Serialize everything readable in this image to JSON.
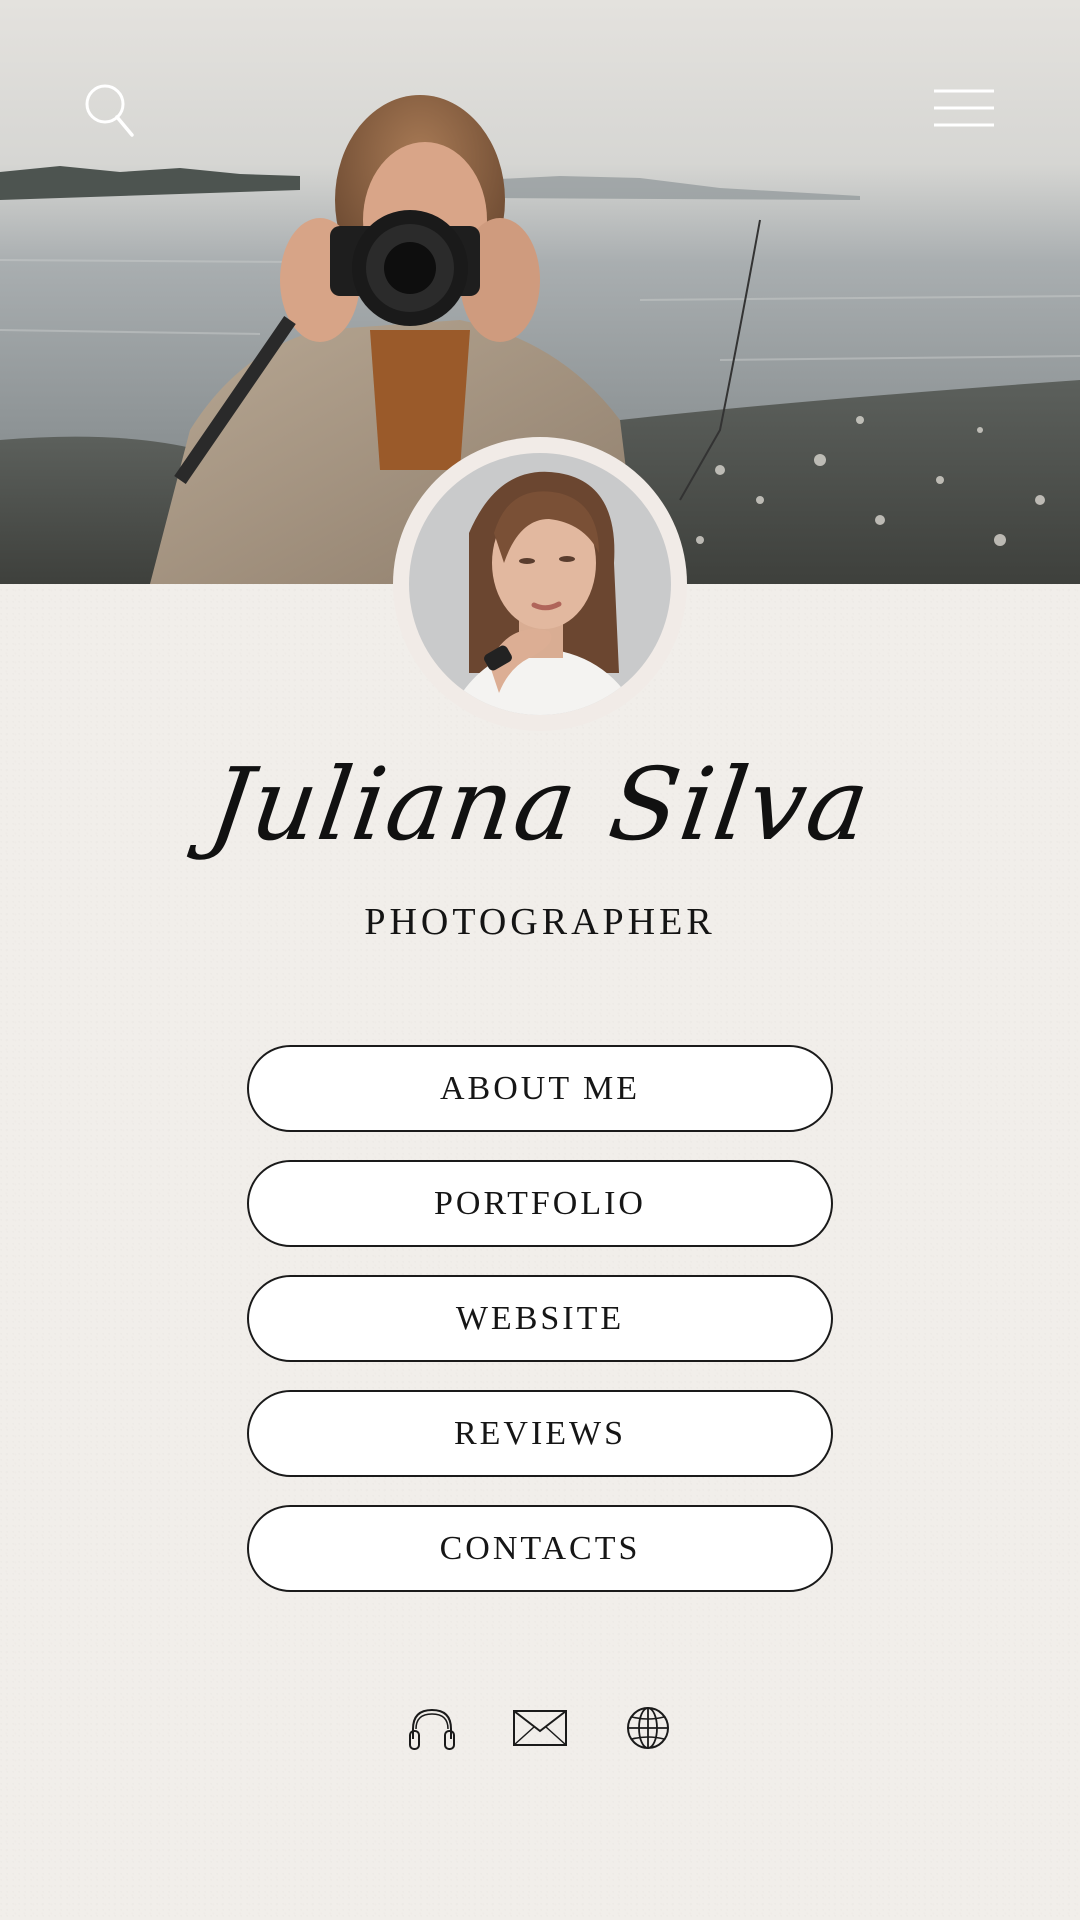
{
  "profile": {
    "name": "Juliana Silva",
    "role": "PHOTOGRAPHER"
  },
  "header": {
    "search_icon": "search-icon",
    "menu_icon": "hamburger-menu-icon"
  },
  "links": [
    {
      "label": "ABOUT ME"
    },
    {
      "label": "PORTFOLIO"
    },
    {
      "label": "WEBSITE"
    },
    {
      "label": "REVIEWS"
    },
    {
      "label": "CONTACTS"
    }
  ],
  "socials": [
    {
      "icon": "headphones-icon"
    },
    {
      "icon": "envelope-icon"
    },
    {
      "icon": "globe-icon"
    }
  ],
  "colors": {
    "background": "#f1eeea",
    "text": "#111111",
    "button_fill": "#ffffff",
    "button_border": "#1a1a1a"
  }
}
